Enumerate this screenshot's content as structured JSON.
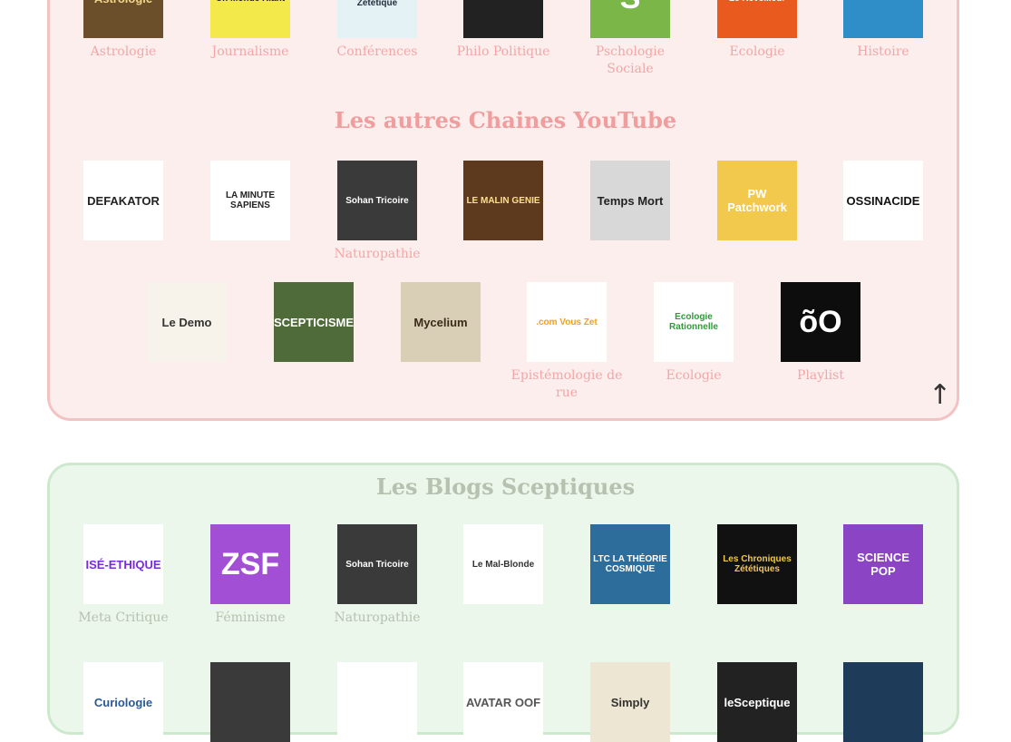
{
  "top_row": [
    {
      "label": "Astrologie",
      "thumb_text": "Astrologie",
      "bg": "#6b4f2a",
      "fg": "#f3d78a"
    },
    {
      "label": "Journalisme",
      "thumb_text": "Un Monde Riant",
      "bg": "#f4e94a",
      "fg": "#1a1a1a"
    },
    {
      "label": "Conférences",
      "thumb_text": "Observatoire Zététique",
      "bg": "#e5f2f5",
      "fg": "#203040"
    },
    {
      "label": "Philo Politique",
      "thumb_text": "",
      "bg": "#222222",
      "fg": "#ffffff"
    },
    {
      "label": "Pschologie Sociale",
      "thumb_text": "S",
      "bg": "#7ab648",
      "fg": "#ffffff"
    },
    {
      "label": "Ecologie",
      "thumb_text": "Le Réveilleur",
      "bg": "#e85a1e",
      "fg": "#ffffff"
    },
    {
      "label": "Histoire",
      "thumb_text": "",
      "bg": "#2f8ec7",
      "fg": "#ffffff"
    }
  ],
  "youtube_section": {
    "title": "Les autres Chaines YouTube",
    "row1": [
      {
        "label": "",
        "thumb_text": "DEFAKATOR",
        "bg": "#ffffff",
        "fg": "#222222"
      },
      {
        "label": "",
        "thumb_text": "LA MINUTE SAPIENS",
        "bg": "#ffffff",
        "fg": "#222222"
      },
      {
        "label": "Naturopathie",
        "thumb_text": "Sohan Tricoire",
        "bg": "#3a3a3a",
        "fg": "#ffffff"
      },
      {
        "label": "",
        "thumb_text": "LE MALIN GENIE",
        "bg": "#5d3a1e",
        "fg": "#ffe08a"
      },
      {
        "label": "",
        "thumb_text": "Temps Mort",
        "bg": "#d8d8d8",
        "fg": "#222222"
      },
      {
        "label": "",
        "thumb_text": "PW Patchwork",
        "bg": "#f2c94c",
        "fg": "#ffffff"
      },
      {
        "label": "",
        "thumb_text": "OSSINACIDE",
        "bg": "#ffffff",
        "fg": "#111111"
      }
    ],
    "row2": [
      {
        "label": "",
        "thumb_text": "Le Demo",
        "bg": "#f7f3ea",
        "fg": "#333333"
      },
      {
        "label": "",
        "thumb_text": "SCEPTICISME",
        "bg": "#4f6b3a",
        "fg": "#ffffff"
      },
      {
        "label": "",
        "thumb_text": "Mycelium",
        "bg": "#d9cfb6",
        "fg": "#3a2a1a"
      },
      {
        "label": "Epistémologie de rue",
        "thumb_text": ".com Vous Zet",
        "bg": "#ffffff",
        "fg": "#f0a020"
      },
      {
        "label": "Ecologie",
        "thumb_text": "Ecologie Rationnelle",
        "bg": "#ffffff",
        "fg": "#2f9a3a"
      },
      {
        "label": "Playlist",
        "thumb_text": "õO",
        "bg": "#0d0d0d",
        "fg": "#ffffff"
      }
    ]
  },
  "blogs_section": {
    "title": "Les Blogs Sceptiques",
    "row1": [
      {
        "label": "Meta Critique",
        "thumb_text": "ISÉ-ETHIQUE",
        "bg": "#ffffff",
        "fg": "#7a2bd8"
      },
      {
        "label": "Féminisme",
        "thumb_text": "ZSF",
        "bg": "#a24fd6",
        "fg": "#ffffff"
      },
      {
        "label": "Naturopathie",
        "thumb_text": "Sohan Tricoire",
        "bg": "#3a3a3a",
        "fg": "#ffffff"
      },
      {
        "label": "",
        "thumb_text": "Le Mal-Blonde",
        "bg": "#ffffff",
        "fg": "#333333"
      },
      {
        "label": "",
        "thumb_text": "LTC LA THÉORIE COSMIQUE",
        "bg": "#2d6d9c",
        "fg": "#ffffff"
      },
      {
        "label": "",
        "thumb_text": "Les Chroniques Zététiques",
        "bg": "#111111",
        "fg": "#f2c94c"
      },
      {
        "label": "",
        "thumb_text": "SCIENCE POP",
        "bg": "#8a44c4",
        "fg": "#ffffff"
      }
    ],
    "row2": [
      {
        "label": "",
        "thumb_text": "Curiologie",
        "bg": "#ffffff",
        "fg": "#2a5a9a"
      },
      {
        "label": "",
        "thumb_text": "",
        "bg": "#3a3a3a",
        "fg": "#ffffff"
      },
      {
        "label": "",
        "thumb_text": "",
        "bg": "#ffffff",
        "fg": "#222222"
      },
      {
        "label": "",
        "thumb_text": "AVATAR OOF",
        "bg": "#ffffff",
        "fg": "#555555"
      },
      {
        "label": "",
        "thumb_text": "Simply",
        "bg": "#ece6d2",
        "fg": "#333333"
      },
      {
        "label": "",
        "thumb_text": "leSceptique",
        "bg": "#222222",
        "fg": "#ffffff"
      },
      {
        "label": "",
        "thumb_text": "",
        "bg": "#1e3c5a",
        "fg": "#ffffff"
      }
    ]
  },
  "back_to_top": "↑"
}
